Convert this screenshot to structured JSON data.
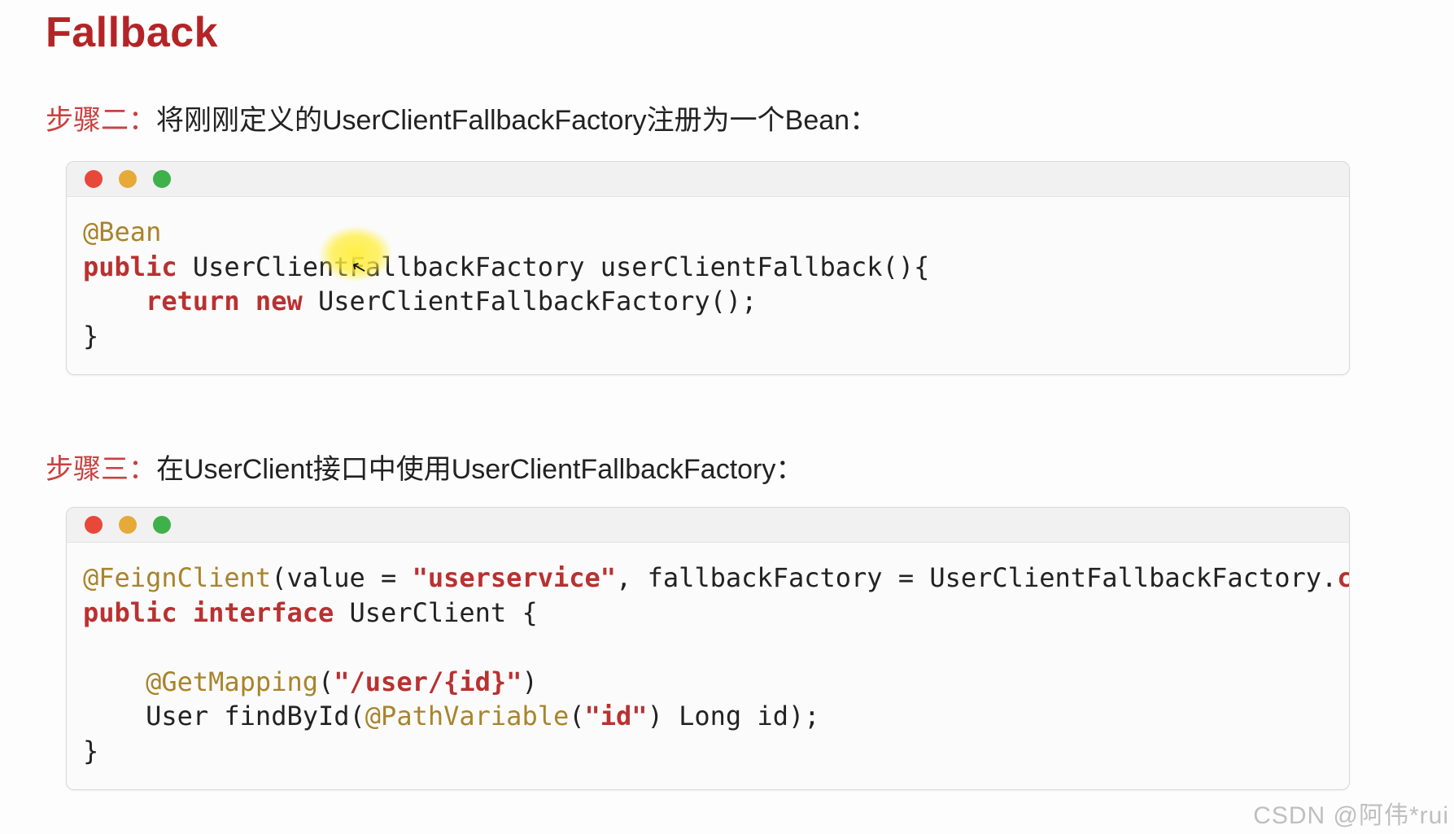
{
  "title": "Fallback",
  "step2": {
    "label_prefix": "步骤二：",
    "label_body": "将刚刚定义的UserClientFallbackFactory注册为一个Bean：",
    "code": {
      "line1_annot": "@Bean",
      "line2_kw": "public",
      "line2_rest": " UserClientFallbackFactory userClientFallback(){",
      "line3_indent": "    ",
      "line3_kw1": "return",
      "line3_sp1": " ",
      "line3_kw2": "new",
      "line3_rest": " UserClientFallbackFactory();",
      "line4": "}"
    }
  },
  "step3": {
    "label_prefix": "步骤三：",
    "label_body": "在UserClient接口中使用UserClientFallbackFactory：",
    "code": {
      "l1_annot": "@FeignClient",
      "l1_after_annot": "(value = ",
      "l1_str": "\"userservice\"",
      "l1_mid": ", fallbackFactory = UserClientFallbackFactory.",
      "l1_kw": "class",
      "l1_end": ")",
      "l2_kw1": "public",
      "l2_sp": " ",
      "l2_kw2": "interface",
      "l2_rest": " UserClient {",
      "l3": "",
      "l4_indent": "    ",
      "l4_annot": "@GetMapping",
      "l4_paren_open": "(",
      "l4_str": "\"/user/{id}\"",
      "l4_paren_close": ")",
      "l5_indent": "    ",
      "l5_text1": "User findById(",
      "l5_annot": "@PathVariable",
      "l5_paren_open": "(",
      "l5_str": "\"id\"",
      "l5_paren_close": ")",
      "l5_text2": " Long id);",
      "l6": "}"
    }
  },
  "watermark": "CSDN @阿伟*rui",
  "icons": {
    "traffic_red": "close-icon",
    "traffic_yellow": "minimize-icon",
    "traffic_green": "maximize-icon"
  }
}
